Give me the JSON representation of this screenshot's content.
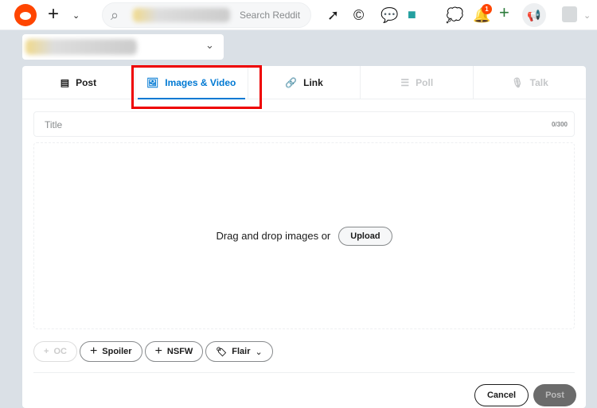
{
  "header": {
    "search_placeholder": "Search Reddit",
    "notification_count": "1"
  },
  "tabs": [
    {
      "label": "Post",
      "icon": "document-icon"
    },
    {
      "label": "Images & Video",
      "icon": "image-icon"
    },
    {
      "label": "Link",
      "icon": "link-icon"
    },
    {
      "label": "Poll",
      "icon": "poll-icon"
    },
    {
      "label": "Talk",
      "icon": "mic-icon"
    }
  ],
  "form": {
    "title_placeholder": "Title",
    "title_count": "0/300",
    "drop_text": "Drag and drop images or",
    "upload_label": "Upload"
  },
  "tags": {
    "oc": "OC",
    "spoiler": "Spoiler",
    "nsfw": "NSFW",
    "flair": "Flair"
  },
  "actions": {
    "cancel": "Cancel",
    "post": "Post"
  }
}
